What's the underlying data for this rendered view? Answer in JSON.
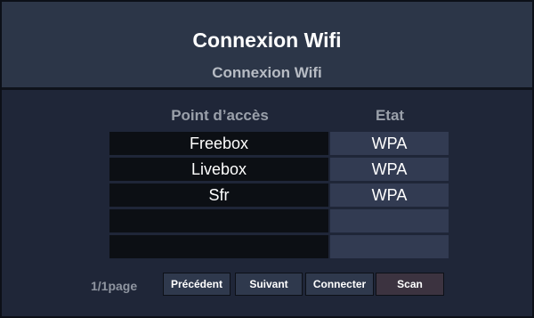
{
  "header": {
    "title": "Connexion Wifi",
    "subtitle": "Connexion Wifi"
  },
  "table": {
    "columns": [
      "Point d’accès",
      "Etat"
    ],
    "rows": [
      {
        "name": "Freebox",
        "state": "WPA"
      },
      {
        "name": "Livebox",
        "state": "WPA"
      },
      {
        "name": "Sfr",
        "state": "WPA"
      },
      {
        "name": "",
        "state": ""
      },
      {
        "name": "",
        "state": ""
      }
    ]
  },
  "footer": {
    "page": "1/1page",
    "prev_label": "Précédent",
    "next_label": "Suivant",
    "connect_label": "Connecter",
    "scan_label": "Scan"
  }
}
